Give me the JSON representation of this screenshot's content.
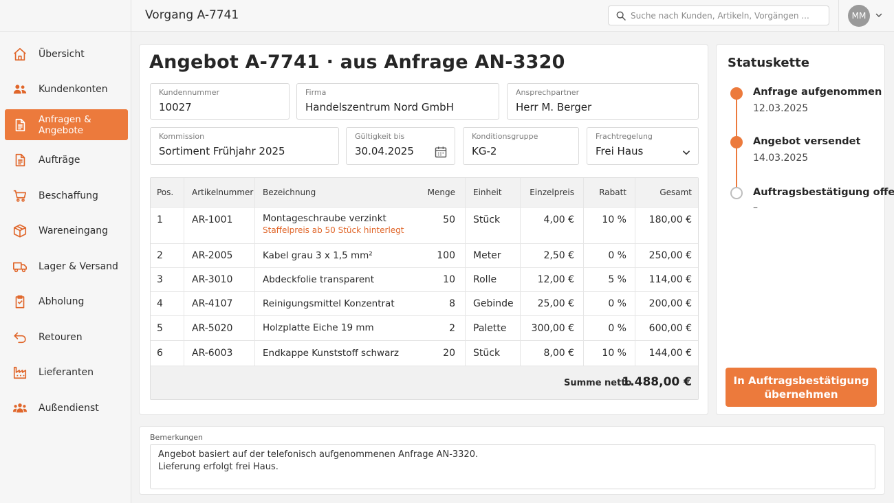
{
  "sidebar": {
    "items": [
      {
        "label": "Übersicht",
        "icon": "home-icon",
        "active": false
      },
      {
        "label": "Kundenkonten",
        "icon": "users-icon",
        "active": false
      },
      {
        "label": "Anfragen & Angebote",
        "icon": "document-icon",
        "active": true
      },
      {
        "label": "Aufträge",
        "icon": "document-icon",
        "active": false
      },
      {
        "label": "Beschaffung",
        "icon": "cart-icon",
        "active": false
      },
      {
        "label": "Wareneingang",
        "icon": "box-icon",
        "active": false
      },
      {
        "label": "Lager & Versand",
        "icon": "truck-icon",
        "active": false
      },
      {
        "label": "Abholung",
        "icon": "clipboard-icon",
        "active": false
      },
      {
        "label": "Retouren",
        "icon": "return-icon",
        "active": false
      },
      {
        "label": "Lieferanten",
        "icon": "factory-icon",
        "active": false
      },
      {
        "label": "Außendienst",
        "icon": "team-icon",
        "active": false
      }
    ]
  },
  "topbar": {
    "title": "Vorgang A-7741",
    "search_placeholder": "Suche nach Kunden, Artikeln, Vorgängen ...",
    "avatar_initials": "MM"
  },
  "colors": {
    "accent": "#ec7a3c",
    "accent_text": "#e0662a",
    "inactive_dot": "#bdbdbd"
  },
  "main": {
    "title": "Angebot A-7741 · aus Anfrage AN-3320",
    "fields": {
      "kundennummer": {
        "label": "Kundennummer",
        "value": "10027"
      },
      "firma": {
        "label": "Firma",
        "value": "Handelszentrum Nord GmbH"
      },
      "ansprechpartner": {
        "label": "Ansprechpartner",
        "value": "Herr M. Berger"
      },
      "kommission": {
        "label": "Kommission",
        "value": "Sortiment Frühjahr 2025"
      },
      "gueltigkeit": {
        "label": "Gültigkeit bis",
        "value": "30.04.2025"
      },
      "konditionsgruppe": {
        "label": "Konditionsgruppe",
        "value": "KG-2"
      },
      "frachtregelung": {
        "label": "Frachtregelung",
        "value": "Frei Haus"
      }
    },
    "table": {
      "headers": {
        "pos": "Pos.",
        "artikelnummer": "Artikelnummer",
        "bezeichnung": "Bezeichnung",
        "menge": "Menge",
        "einheit": "Einheit",
        "einzelpreis": "Einzelpreis",
        "rabatt": "Rabatt",
        "gesamt": "Gesamt"
      },
      "rows": [
        {
          "pos": "1",
          "artikelnummer": "AR-1001",
          "bezeichnung": "Montageschraube verzinkt",
          "hinweis": "Staffelpreis ab 50 Stück hinterlegt",
          "menge": "50",
          "einheit": "Stück",
          "einzelpreis": "4,00 €",
          "rabatt": "10 %",
          "gesamt": "180,00 €"
        },
        {
          "pos": "2",
          "artikelnummer": "AR-2005",
          "bezeichnung": "Kabel grau 3 x 1,5 mm²",
          "menge": "100",
          "einheit": "Meter",
          "einzelpreis": "2,50 €",
          "rabatt": "0 %",
          "gesamt": "250,00 €"
        },
        {
          "pos": "3",
          "artikelnummer": "AR-3010",
          "bezeichnung": "Abdeckfolie transparent",
          "menge": "10",
          "einheit": "Rolle",
          "einzelpreis": "12,00 €",
          "rabatt": "5 %",
          "gesamt": "114,00 €"
        },
        {
          "pos": "4",
          "artikelnummer": "AR-4107",
          "bezeichnung": "Reinigungsmittel Konzentrat",
          "menge": "8",
          "einheit": "Gebinde",
          "einzelpreis": "25,00 €",
          "rabatt": "0 %",
          "gesamt": "200,00 €"
        },
        {
          "pos": "5",
          "artikelnummer": "AR-5020",
          "bezeichnung": "Holzplatte Eiche 19 mm",
          "menge": "2",
          "einheit": "Palette",
          "einzelpreis": "300,00 €",
          "rabatt": "0 %",
          "gesamt": "600,00 €"
        },
        {
          "pos": "6",
          "artikelnummer": "AR-6003",
          "bezeichnung": "Endkappe Kunststoff schwarz",
          "menge": "20",
          "einheit": "Stück",
          "einzelpreis": "8,00 €",
          "rabatt": "10 %",
          "gesamt": "144,00 €"
        }
      ],
      "sum_label": "Summe netto",
      "sum_value": "1.488,00 €"
    }
  },
  "status": {
    "title": "Statuskette",
    "steps": [
      {
        "title": "Anfrage aufgenommen",
        "date": "12.03.2025",
        "done": true
      },
      {
        "title": "Angebot versendet",
        "date": "14.03.2025",
        "done": true
      },
      {
        "title": "Auftragsbestätigung offen",
        "date": "–",
        "done": false
      }
    ],
    "button_label": "In Auftragsbestätigung übernehmen"
  },
  "notes": {
    "label": "Bemerkungen",
    "lines": [
      "Angebot basiert auf der telefonisch aufgenommenen Anfrage AN-3320.",
      "Lieferung erfolgt frei Haus."
    ]
  }
}
